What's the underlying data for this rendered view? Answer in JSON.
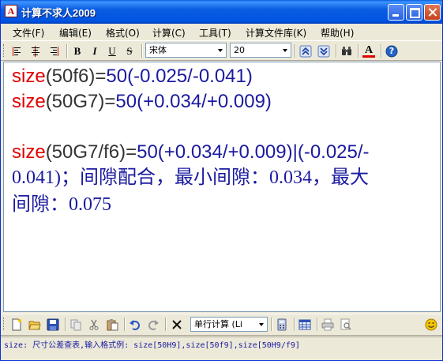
{
  "window": {
    "title": "计算不求人2009",
    "icon_letter": "A",
    "accent": "#0054e3",
    "close_color": "#c4401b"
  },
  "menu": [
    {
      "label": "文件(F)"
    },
    {
      "label": "编辑(E)"
    },
    {
      "label": "格式(O)"
    },
    {
      "label": "计算(C)"
    },
    {
      "label": "工具(T)"
    },
    {
      "label": "计算文件库(K)"
    },
    {
      "label": "帮助(H)"
    }
  ],
  "format_toolbar": {
    "bold_label": "B",
    "italic_label": "I",
    "underline_label": "U",
    "strike_label": "S",
    "font_name": "宋体",
    "font_size": "20",
    "text_color_label": "A",
    "help_label": "?"
  },
  "editor": {
    "lines": [
      {
        "prefix": "size",
        "paren": "(50f6)=",
        "num": "50",
        "rest": "(-0.025/-0.041)"
      },
      {
        "prefix": "size",
        "paren": "(50G7)=",
        "num": "50",
        "rest": "(+0.034/+0.009)"
      }
    ],
    "fit_line": {
      "prefix": "size",
      "paren": "(50G7/f6)=",
      "num": "50",
      "rest": "(+0.034/+0.009)|(-0.025/-",
      "line2": "0.041)；间隙配合，最小间隙：0.034，最大",
      "line3": "间隙：0.075"
    },
    "colors": {
      "keyword": "#e00000",
      "value": "#1a1aa0"
    }
  },
  "bottom_toolbar": {
    "mode_select": "单行计算 (Li"
  },
  "status": {
    "text": "size: 尺寸公差查表,输入格式例: size[50H9],size[50f9],size[50H9/f9]"
  }
}
